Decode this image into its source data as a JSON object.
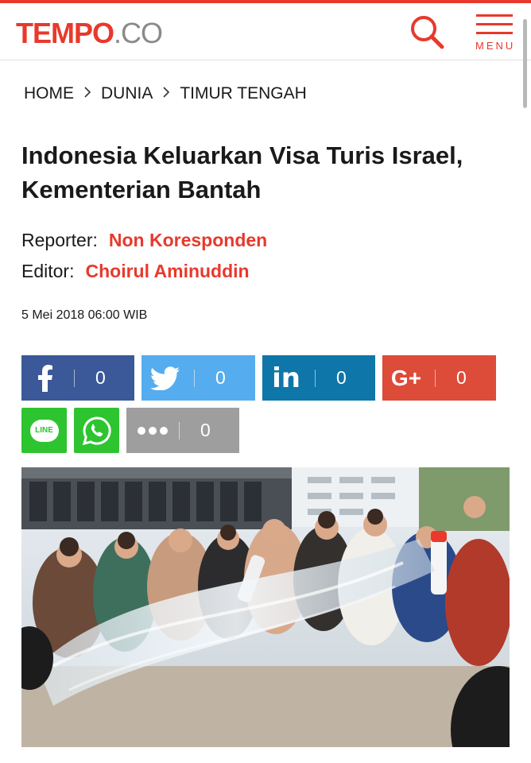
{
  "header": {
    "logo_brand": "TEMPO",
    "logo_tld": ".CO",
    "menu_label": "MENU"
  },
  "breadcrumb": [
    "HOME",
    "DUNIA",
    "TIMUR TENGAH"
  ],
  "article": {
    "title": "Indonesia Keluarkan Visa Turis Israel, Kementerian Bantah",
    "reporter_label": "Reporter:",
    "reporter_name": "Non Koresponden",
    "editor_label": "Editor:",
    "editor_name": "Choirul Aminuddin",
    "date": "5 Mei 2018 06:00 WIB"
  },
  "share": {
    "facebook_count": "0",
    "twitter_count": "0",
    "linkedin_count": "0",
    "google_plus_count": "0",
    "more_count": "0",
    "line_label": "LINE",
    "google_plus_label": "G+"
  },
  "colors": {
    "brand": "#e8392c",
    "facebook": "#3b5998",
    "twitter": "#55acee",
    "linkedin": "#0e76a8",
    "google_plus": "#dd4b39",
    "line": "#2dc430",
    "whatsapp": "#2dc430",
    "more": "#9e9e9e"
  },
  "photo": {
    "alt_icon": "article-photo"
  }
}
